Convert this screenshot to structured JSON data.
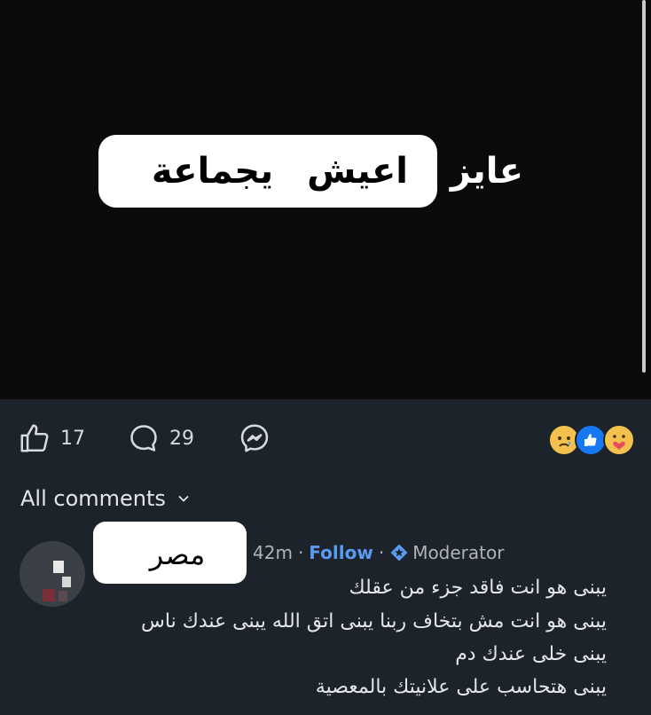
{
  "post_media": {
    "outer_text": "عايز",
    "bubble_text": "اعيش يجماعة"
  },
  "actions": {
    "like_count": "17",
    "comment_count": "29",
    "reactions": [
      "sad-face",
      "like-thumb",
      "care-hug"
    ]
  },
  "comments": {
    "sort_label": "All comments",
    "items": [
      {
        "author": "مصر",
        "time": "42m",
        "separator": "·",
        "follow_label": "Follow",
        "badge": "Moderator",
        "lines": [
          "يبنى هو انت فاقد جزء من عقلك",
          "يبنى هو انت مش بتخاف ربنا يبنى اتق الله يبنى عندك ناس",
          "يبنى خلى عندك دم",
          "يبنى هتحاسب على علانيتك بالمعصية"
        ]
      }
    ]
  },
  "colors": {
    "background": "#1d232a",
    "media_background": "#0b0b0d",
    "follow_link": "#5a9bf0",
    "like_blue": "#1877f2"
  }
}
